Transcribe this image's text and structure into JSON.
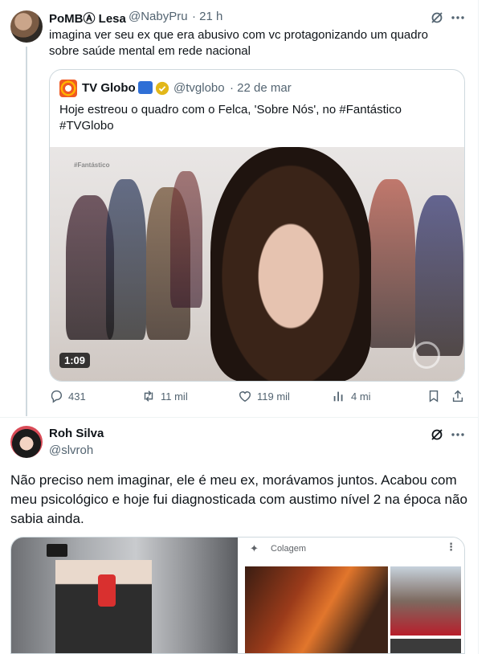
{
  "tweet1": {
    "display_name": "PoMBⒶ Lesa",
    "handle": "@NabyPru",
    "time": "· 21 h",
    "text": "imagina ver seu ex que era abusivo com vc protagonizando um quadro sobre saúde mental em rede nacional",
    "quote": {
      "display_name": "TV Globo",
      "handle": "@tvglobo",
      "time": "· 22 de mar",
      "text": "Hoje estreou o quadro com o Felca, 'Sobre Nós', no #Fantástico #TVGlobo",
      "video_tag": "#Fantástico",
      "video_duration": "1:09"
    },
    "stats": {
      "replies": "431",
      "retweets": "11 mil",
      "likes": "119 mil",
      "views": "4 mi"
    }
  },
  "tweet2": {
    "display_name": "Roh Silva",
    "handle": "@slvroh",
    "text": "Não preciso nem imaginar, ele é meu ex, morávamos juntos. Acabou com meu psicológico e hoje fui diagnosticada com austimo nível 2 na época não sabia ainda.",
    "media_right_label": "Colagem"
  },
  "colors": {
    "text": "#0f1419",
    "secondary": "#536471",
    "border": "#cfd9de",
    "verified_gold": "#e2b719"
  },
  "icons": [
    "grok-icon",
    "more-icon",
    "reply-icon",
    "retweet-icon",
    "like-icon",
    "views-icon",
    "bookmark-icon",
    "share-icon",
    "tv-icon",
    "verified-icon",
    "sparkle-icon"
  ]
}
